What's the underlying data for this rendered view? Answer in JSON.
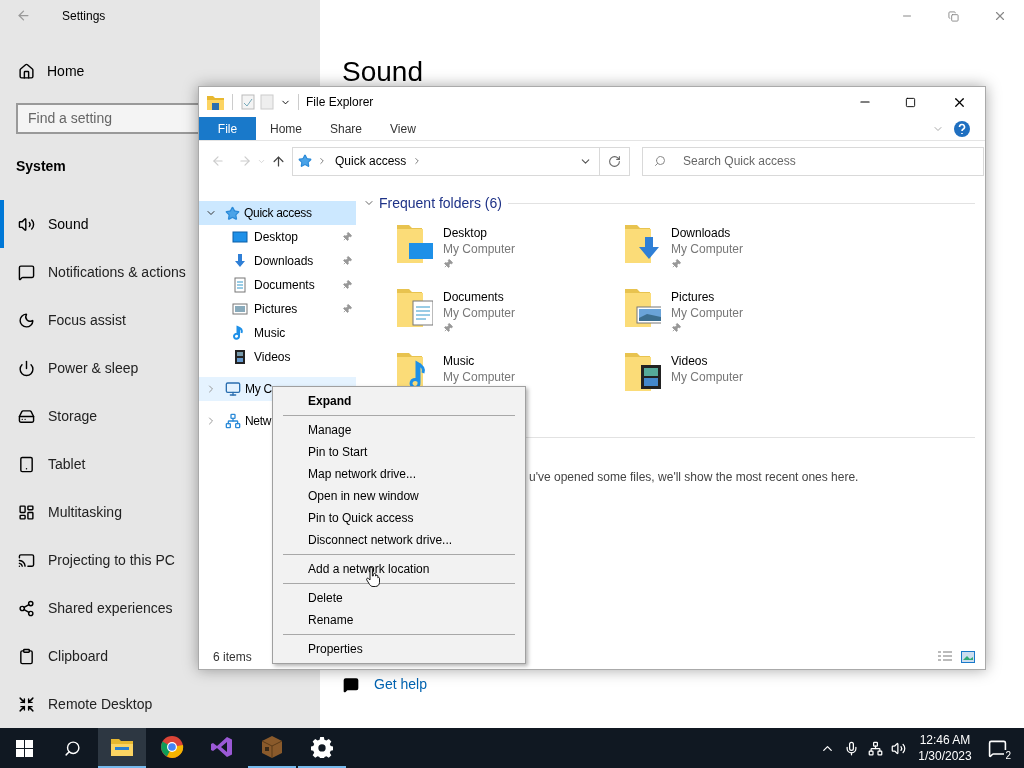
{
  "settings": {
    "title": "Settings",
    "home": "Home",
    "search": {
      "placeholder": "Find a setting"
    },
    "section": "System",
    "nav": [
      {
        "label": "Sound",
        "selected": true
      },
      {
        "label": "Notifications & actions",
        "selected": false
      },
      {
        "label": "Focus assist",
        "selected": false
      },
      {
        "label": "Power & sleep",
        "selected": false
      },
      {
        "label": "Storage",
        "selected": false
      },
      {
        "label": "Tablet",
        "selected": false
      },
      {
        "label": "Multitasking",
        "selected": false
      },
      {
        "label": "Projecting to this PC",
        "selected": false
      },
      {
        "label": "Shared experiences",
        "selected": false
      },
      {
        "label": "Clipboard",
        "selected": false
      },
      {
        "label": "Remote Desktop",
        "selected": false
      }
    ],
    "page_title": "Sound",
    "help_link": "Get help"
  },
  "explorer": {
    "title": "File Explorer",
    "ribbon_tabs": [
      {
        "label": "File",
        "selected": true
      },
      {
        "label": "Home",
        "selected": false
      },
      {
        "label": "Share",
        "selected": false
      },
      {
        "label": "View",
        "selected": false
      }
    ],
    "address": "Quick access",
    "search": {
      "placeholder": "Search Quick access"
    },
    "tree": [
      {
        "label": "Quick access",
        "selected": true,
        "hovered": false,
        "expanded": true,
        "children": [
          {
            "label": "Desktop",
            "pinned": true
          },
          {
            "label": "Downloads",
            "pinned": true
          },
          {
            "label": "Documents",
            "pinned": true
          },
          {
            "label": "Pictures",
            "pinned": true
          },
          {
            "label": "Music",
            "pinned": false
          },
          {
            "label": "Videos",
            "pinned": false
          }
        ]
      },
      {
        "label": "My C",
        "selected": false,
        "hovered": true,
        "expanded": false
      },
      {
        "label": "Netw",
        "selected": false,
        "hovered": false,
        "expanded": false
      }
    ],
    "section_title": "Frequent folders (6)",
    "folders": [
      {
        "name": "Desktop",
        "location": "My Computer",
        "pinned": true
      },
      {
        "name": "Downloads",
        "location": "My Computer",
        "pinned": true
      },
      {
        "name": "Documents",
        "location": "My Computer",
        "pinned": true
      },
      {
        "name": "Pictures",
        "location": "My Computer",
        "pinned": true
      },
      {
        "name": "Music",
        "location": "My Computer",
        "pinned": false
      },
      {
        "name": "Videos",
        "location": "My Computer",
        "pinned": false
      }
    ],
    "recent_note": "u've opened some files, we'll show the most recent ones here.",
    "status": "6 items"
  },
  "context_menu": {
    "items": [
      {
        "kind": "item",
        "label": "Expand",
        "bold": true
      },
      {
        "kind": "separator"
      },
      {
        "kind": "item",
        "label": "Manage",
        "bold": false
      },
      {
        "kind": "item",
        "label": "Pin to Start",
        "bold": false
      },
      {
        "kind": "item",
        "label": "Map network drive...",
        "bold": false
      },
      {
        "kind": "item",
        "label": "Open in new window",
        "bold": false
      },
      {
        "kind": "item",
        "label": "Pin to Quick access",
        "bold": false
      },
      {
        "kind": "item",
        "label": "Disconnect network drive...",
        "bold": false
      },
      {
        "kind": "separator"
      },
      {
        "kind": "item",
        "label": "Add a network location",
        "bold": false
      },
      {
        "kind": "separator"
      },
      {
        "kind": "item",
        "label": "Delete",
        "bold": false
      },
      {
        "kind": "item",
        "label": "Rename",
        "bold": false
      },
      {
        "kind": "separator"
      },
      {
        "kind": "item",
        "label": "Properties",
        "bold": false
      }
    ]
  },
  "taskbar": {
    "apps": [
      {
        "running": true,
        "active": true
      },
      {
        "running": false,
        "active": false
      },
      {
        "running": false,
        "active": false
      },
      {
        "running": true,
        "active": false
      },
      {
        "running": true,
        "active": false
      }
    ],
    "time": "12:46 AM",
    "date": "1/30/2023",
    "notifications": "2"
  }
}
